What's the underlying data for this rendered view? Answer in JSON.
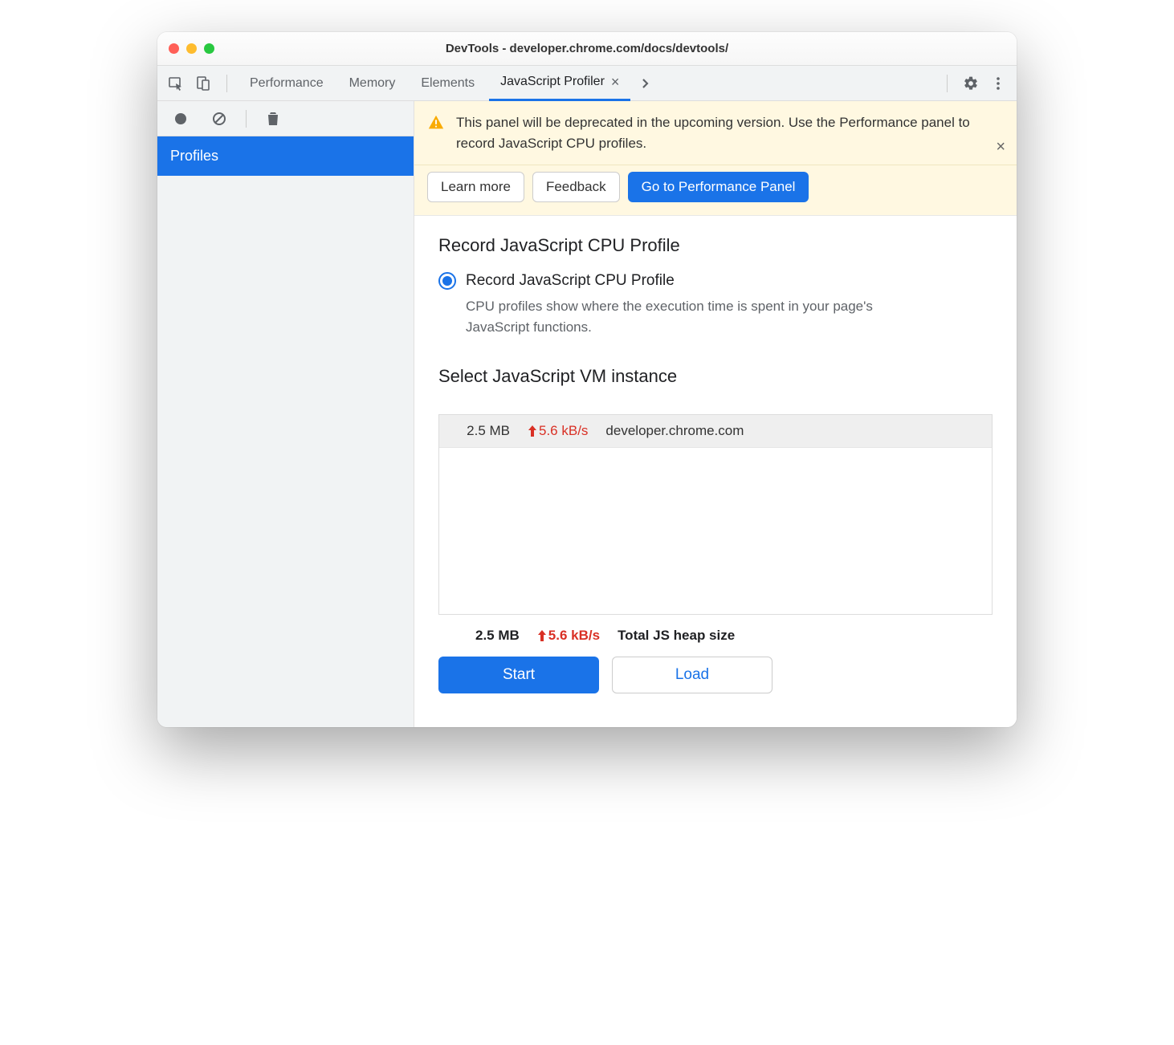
{
  "window": {
    "title": "DevTools - developer.chrome.com/docs/devtools/"
  },
  "tabs": {
    "items": [
      "Performance",
      "Memory",
      "Elements",
      "JavaScript Profiler"
    ],
    "activeIndex": 3
  },
  "sidebar": {
    "items": [
      {
        "label": "Profiles",
        "selected": true
      }
    ]
  },
  "banner": {
    "text": "This panel will be deprecated in the upcoming version. Use the Performance panel to record JavaScript CPU profiles.",
    "learn_more": "Learn more",
    "feedback": "Feedback",
    "goto": "Go to Performance Panel"
  },
  "main": {
    "heading": "Record JavaScript CPU Profile",
    "radio_label": "Record JavaScript CPU Profile",
    "radio_desc": "CPU profiles show where the execution time is spent in your page's JavaScript functions.",
    "vm_heading": "Select JavaScript VM instance",
    "vm_row": {
      "size": "2.5 MB",
      "rate": "5.6 kB/s",
      "name": "developer.chrome.com"
    },
    "totals": {
      "size": "2.5 MB",
      "rate": "5.6 kB/s",
      "label": "Total JS heap size"
    },
    "start": "Start",
    "load": "Load"
  }
}
